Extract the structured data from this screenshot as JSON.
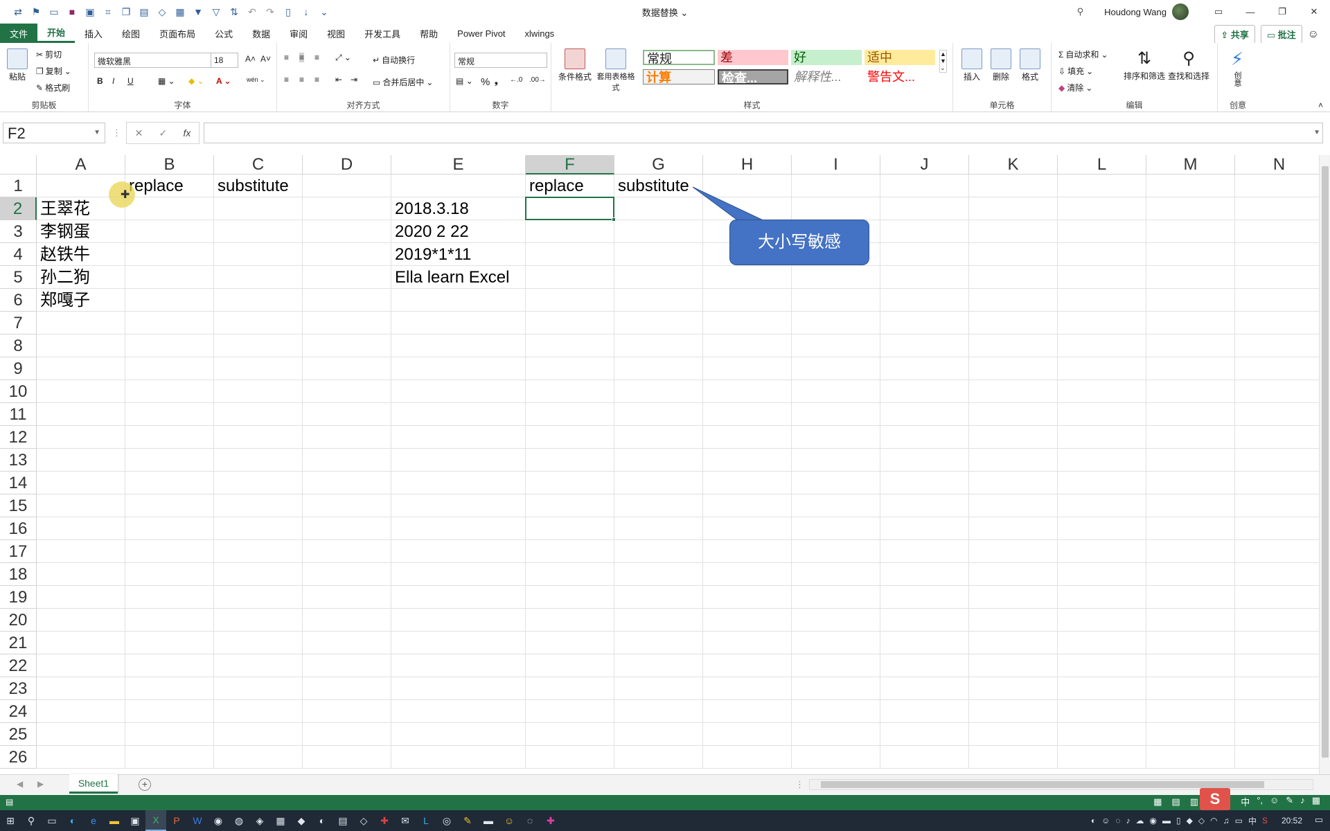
{
  "window": {
    "title": "数据替换",
    "user": "Houdong Wang"
  },
  "ribbon_tabs": [
    "文件",
    "开始",
    "插入",
    "绘图",
    "页面布局",
    "公式",
    "数据",
    "审阅",
    "视图",
    "开发工具",
    "帮助",
    "Power Pivot",
    "xlwings"
  ],
  "ribbon_actions": {
    "share": "共享",
    "comments": "批注"
  },
  "ribbon": {
    "clipboard": {
      "label": "剪贴板",
      "paste": "粘贴",
      "cut": "剪切",
      "copy": "复制",
      "format_painter": "格式刷"
    },
    "font": {
      "label": "字体",
      "font_name": "微软雅黑",
      "font_size": "18",
      "bold": "B",
      "italic": "I",
      "underline": "U"
    },
    "alignment": {
      "label": "对齐方式",
      "wrap": "自动换行",
      "merge": "合并后居中"
    },
    "number": {
      "label": "数字",
      "format": "常规",
      "percent": "%"
    },
    "styles": {
      "label": "样式",
      "conditional": "条件格式",
      "table_format": "套用表格格式",
      "cells": [
        "常规",
        "差",
        "好",
        "适中",
        "计算",
        "检查...",
        "解释性...",
        "警告文..."
      ]
    },
    "cells_group": {
      "label": "单元格",
      "insert": "插入",
      "delete": "删除",
      "format": "格式"
    },
    "editing": {
      "label": "编辑",
      "autosum": "自动求和",
      "fill": "填充",
      "clear": "清除",
      "sort": "排序和筛选",
      "find": "查找和选择"
    },
    "creative": {
      "label": "创意",
      "btn": "创意"
    }
  },
  "formula_bar": {
    "name_box": "F2",
    "formula": ""
  },
  "columns": [
    "A",
    "B",
    "C",
    "D",
    "E",
    "F",
    "G",
    "H",
    "I",
    "J",
    "K",
    "L",
    "M",
    "N"
  ],
  "rows": [
    "1",
    "2",
    "3",
    "4",
    "5",
    "6",
    "7",
    "8",
    "9",
    "10",
    "11",
    "12",
    "13",
    "14",
    "15",
    "16",
    "17",
    "18",
    "19",
    "20",
    "21",
    "22",
    "23",
    "24",
    "25",
    "26"
  ],
  "cells": {
    "B1": "replace",
    "C1": "substitute",
    "F1": "replace",
    "G1": "substitute",
    "A2": "王翠花",
    "A3": "李钢蛋",
    "A4": "赵铁牛",
    "A5": "孙二狗",
    "A6": "郑嘎子",
    "E2": "2018.3.18",
    "E3": "2020 2 22",
    "E4": "2019*1*11",
    "E5": "Ella learn Excel"
  },
  "selected_cell": "F2",
  "callout": {
    "text": "大小写敏感"
  },
  "sheet_tabs": [
    "Sheet1"
  ],
  "clock": "20:52",
  "ime": "中"
}
